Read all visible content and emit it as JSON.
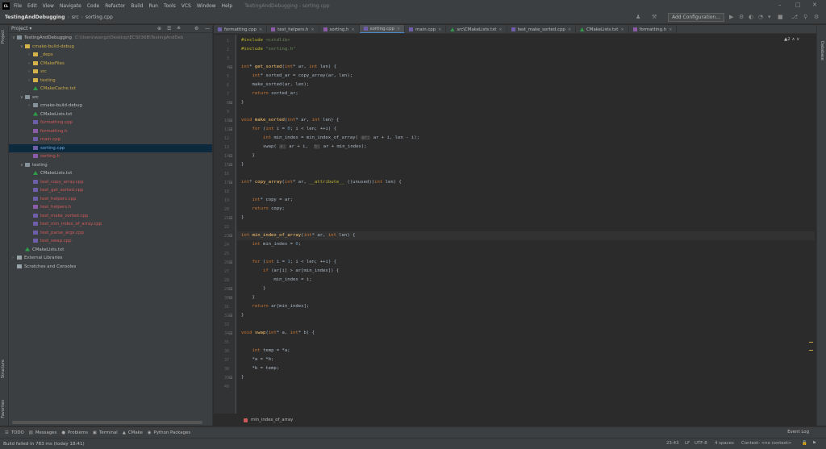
{
  "window": {
    "title": "TestingAndDebugging - sorting.cpp",
    "menu": [
      "File",
      "Edit",
      "View",
      "Navigate",
      "Code",
      "Refactor",
      "Build",
      "Run",
      "Tools",
      "VCS",
      "Window",
      "Help"
    ],
    "controls": {
      "minimize": "–",
      "maximize": "□",
      "close": "✕"
    }
  },
  "navbar": {
    "project": "TestingAndDebugging",
    "crumbs": [
      "src",
      "sorting.cpp"
    ],
    "add_config_label": "Add Configuration..."
  },
  "sidetools": {
    "left": [
      "Project",
      "Structure",
      "Favorites"
    ],
    "right": [
      "Database"
    ]
  },
  "project_panel": {
    "title": "Project ▾",
    "tree": [
      {
        "label": "TestingAndDebugging",
        "path": "C:\\Users\\wangz\\Desktop\\ECS036B\\TestingAndDeb",
        "indent": 0,
        "arrow": "∨",
        "icon": "folder",
        "color": ""
      },
      {
        "label": "cmake-build-debug",
        "indent": 1,
        "arrow": "∨",
        "icon": "fold-y",
        "color": "ylw"
      },
      {
        "label": "_deps",
        "indent": 2,
        "arrow": "›",
        "icon": "fold-y",
        "color": "ylw"
      },
      {
        "label": "CMakeFiles",
        "indent": 2,
        "arrow": "›",
        "icon": "fold-y",
        "color": "ylw"
      },
      {
        "label": "src",
        "indent": 2,
        "arrow": "›",
        "icon": "fold-y",
        "color": "ylw"
      },
      {
        "label": "testing",
        "indent": 2,
        "arrow": "›",
        "icon": "fold-y",
        "color": "ylw"
      },
      {
        "label": "CMakeCache.txt",
        "indent": 2,
        "arrow": "",
        "icon": "txt",
        "color": "ylw"
      },
      {
        "label": "src",
        "indent": 1,
        "arrow": "∨",
        "icon": "folder",
        "color": ""
      },
      {
        "label": "cmake-build-debug",
        "indent": 2,
        "arrow": "›",
        "icon": "folder",
        "color": ""
      },
      {
        "label": "CMakeLists.txt",
        "indent": 2,
        "arrow": "",
        "icon": "txt",
        "color": ""
      },
      {
        "label": "formatting.cpp",
        "indent": 2,
        "arrow": "",
        "icon": "cpp",
        "color": "rgr"
      },
      {
        "label": "formatting.h",
        "indent": 2,
        "arrow": "",
        "icon": "hdr",
        "color": "rgr"
      },
      {
        "label": "main.cpp",
        "indent": 2,
        "arrow": "",
        "icon": "cpp",
        "color": "rgr"
      },
      {
        "label": "sorting.cpp",
        "indent": 2,
        "arrow": "",
        "icon": "cpp",
        "color": "bl",
        "selected": true
      },
      {
        "label": "sorting.h",
        "indent": 2,
        "arrow": "",
        "icon": "hdr",
        "color": "rgr"
      },
      {
        "label": "testing",
        "indent": 1,
        "arrow": "∨",
        "icon": "folder",
        "color": ""
      },
      {
        "label": "CMakeLists.txt",
        "indent": 2,
        "arrow": "",
        "icon": "txt",
        "color": ""
      },
      {
        "label": "test_copy_array.cpp",
        "indent": 2,
        "arrow": "",
        "icon": "cpp",
        "color": "rgr"
      },
      {
        "label": "test_get_sorted.cpp",
        "indent": 2,
        "arrow": "",
        "icon": "cpp",
        "color": "rgr"
      },
      {
        "label": "test_helpers.cpp",
        "indent": 2,
        "arrow": "",
        "icon": "cpp",
        "color": "rgr"
      },
      {
        "label": "test_helpers.h",
        "indent": 2,
        "arrow": "",
        "icon": "hdr",
        "color": "rgr"
      },
      {
        "label": "test_make_sorted.cpp",
        "indent": 2,
        "arrow": "",
        "icon": "cpp",
        "color": "rgr"
      },
      {
        "label": "test_min_index_of_array.cpp",
        "indent": 2,
        "arrow": "",
        "icon": "cpp",
        "color": "rgr"
      },
      {
        "label": "test_parse_args.cpp",
        "indent": 2,
        "arrow": "",
        "icon": "cpp",
        "color": "rgr"
      },
      {
        "label": "test_swap.cpp",
        "indent": 2,
        "arrow": "",
        "icon": "cpp",
        "color": "rgr"
      },
      {
        "label": "CMakeLists.txt",
        "indent": 1,
        "arrow": "",
        "icon": "txt",
        "color": ""
      },
      {
        "label": "External Libraries",
        "indent": 0,
        "arrow": "›",
        "icon": "lib",
        "color": ""
      },
      {
        "label": "Scratches and Consoles",
        "indent": 0,
        "arrow": "",
        "icon": "lib",
        "color": ""
      }
    ]
  },
  "tabs": [
    {
      "label": "formatting.cpp",
      "icon": "cpp"
    },
    {
      "label": "test_helpers.h",
      "icon": "hdr"
    },
    {
      "label": "sorting.h",
      "icon": "hdr"
    },
    {
      "label": "sorting.cpp",
      "icon": "cpp",
      "active": true
    },
    {
      "label": "main.cpp",
      "icon": "cpp"
    },
    {
      "label": "src\\CMakeLists.txt",
      "icon": "txt"
    },
    {
      "label": "test_make_sorted.cpp",
      "icon": "cpp"
    },
    {
      "label": "CMakeLists.txt",
      "icon": "txt"
    },
    {
      "label": "formatting.h",
      "icon": "hdr"
    }
  ],
  "editor": {
    "line_numbers": [
      "1",
      "2",
      "3",
      "4",
      "5",
      "6",
      "7",
      "8",
      "9",
      "10",
      "11",
      "12",
      "13",
      "14",
      "15",
      "16",
      "17",
      "18",
      "19",
      "20",
      "21",
      "22",
      "23",
      "24",
      "25",
      "26",
      "27",
      "28",
      "29",
      "30",
      "31",
      "32",
      "33",
      "34",
      "35",
      "36",
      "37",
      "38",
      "39",
      "40"
    ],
    "current_line": "23",
    "inspection": "▲2 ∧ ∨",
    "lines": [
      [
        [
          "pp",
          "#include "
        ],
        [
          "s",
          "<cstdlib>"
        ]
      ],
      [
        [
          "pp",
          "#include "
        ],
        [
          "s",
          "\"sorting.h\""
        ]
      ],
      [],
      [
        [
          "k",
          "int"
        ],
        [
          "",
          "* "
        ],
        [
          "f",
          "get_sorted"
        ],
        [
          "",
          "("
        ],
        [
          "k",
          "int"
        ],
        [
          "",
          "* ar, "
        ],
        [
          "k",
          "int"
        ],
        [
          "",
          " len) {"
        ]
      ],
      [
        [
          "",
          "    "
        ],
        [
          "k",
          "int"
        ],
        [
          "",
          "* sorted_ar = copy_array(ar, len);"
        ]
      ],
      [
        [
          "",
          "    make_sorted(ar, len);"
        ]
      ],
      [
        [
          "",
          "    "
        ],
        [
          "k",
          "return"
        ],
        [
          "",
          ""
        ],
        [
          "",
          "",
          " "
        ],
        [
          "",
          "sorted_ar;"
        ]
      ],
      [
        [
          "",
          "}"
        ]
      ],
      [],
      [
        [
          "k",
          "void "
        ],
        [
          "f",
          "make_sorted"
        ],
        [
          "",
          "("
        ],
        [
          "k",
          "int"
        ],
        [
          "",
          "* ar, "
        ],
        [
          "k",
          "int"
        ],
        [
          "",
          " len) {"
        ]
      ],
      [
        [
          "",
          "    "
        ],
        [
          "k",
          "for "
        ],
        [
          "",
          "("
        ],
        [
          "k",
          "int "
        ],
        [
          "",
          "i = "
        ],
        [
          "n",
          "0"
        ],
        [
          "",
          "; i < len; ++i) {"
        ]
      ],
      [
        [
          "",
          "        "
        ],
        [
          "k",
          "int "
        ],
        [
          "",
          "min_index = min_index_of_array( "
        ],
        [
          "p",
          "ar:"
        ],
        [
          "",
          " ar + i, len - i);"
        ]
      ],
      [
        [
          "",
          "        swap( "
        ],
        [
          "p",
          "a:"
        ],
        [
          "",
          " ar + i,  "
        ],
        [
          "p",
          "b:"
        ],
        [
          "",
          " ar + min_index);"
        ]
      ],
      [
        [
          "",
          "    }"
        ]
      ],
      [
        [
          "",
          "}"
        ]
      ],
      [],
      [
        [
          "k",
          "int"
        ],
        [
          "",
          "* "
        ],
        [
          "f",
          "copy_array"
        ],
        [
          "",
          "("
        ],
        [
          "k",
          "int"
        ],
        [
          "",
          "* ar, "
        ],
        [
          "h",
          "__attribute__ "
        ],
        [
          "",
          "((unused))"
        ],
        [
          "k",
          "int "
        ],
        [
          "",
          "len) {"
        ]
      ],
      [],
      [
        [
          "",
          "    "
        ],
        [
          "k",
          "int"
        ],
        [
          "",
          "* copy = ar;"
        ]
      ],
      [
        [
          "",
          "    "
        ],
        [
          "k",
          "return "
        ],
        [
          "",
          "copy;"
        ]
      ],
      [
        [
          "",
          "}"
        ]
      ],
      [],
      [
        [
          "k",
          "int "
        ],
        [
          "f",
          "min_index_of_array"
        ],
        [
          "",
          "("
        ],
        [
          "k",
          "int"
        ],
        [
          "",
          "* ar, "
        ],
        [
          "k",
          "int "
        ],
        [
          "",
          "len) {"
        ]
      ],
      [
        [
          "",
          "    "
        ],
        [
          "k",
          "int "
        ],
        [
          "",
          "min_index = "
        ],
        [
          "n",
          "0"
        ],
        [
          "",
          ";"
        ]
      ],
      [],
      [
        [
          "",
          "    "
        ],
        [
          "k",
          "for "
        ],
        [
          "",
          "("
        ],
        [
          "k",
          "int "
        ],
        [
          "",
          "i = "
        ],
        [
          "n",
          "1"
        ],
        [
          "",
          "; i < len; ++i) {"
        ]
      ],
      [
        [
          "",
          "        "
        ],
        [
          "k",
          "if "
        ],
        [
          "",
          "(ar[i] > ar[min_index]) {"
        ]
      ],
      [
        [
          "",
          "            min_index = i;"
        ]
      ],
      [
        [
          "",
          "        }"
        ]
      ],
      [
        [
          "",
          "    }"
        ]
      ],
      [
        [
          "",
          "    "
        ],
        [
          "k",
          "return "
        ],
        [
          "",
          "ar[min_index];"
        ]
      ],
      [
        [
          "",
          "}"
        ]
      ],
      [],
      [
        [
          "k",
          "void "
        ],
        [
          "f",
          "swap"
        ],
        [
          "",
          "("
        ],
        [
          "k",
          "int"
        ],
        [
          "",
          "* a, "
        ],
        [
          "k",
          "int"
        ],
        [
          "",
          "* b) {"
        ]
      ],
      [],
      [
        [
          "",
          "    "
        ],
        [
          "k",
          "int "
        ],
        [
          "",
          "temp = *a;"
        ]
      ],
      [
        [
          "",
          "    *a = *b;"
        ]
      ],
      [
        [
          "",
          "    *b = temp;"
        ]
      ],
      [
        [
          "",
          "}"
        ]
      ],
      []
    ]
  },
  "code_crumb": "min_index_of_array",
  "bottom_tools": [
    {
      "icon": "☰",
      "label": "TODO"
    },
    {
      "icon": "▤",
      "label": "Messages"
    },
    {
      "icon": "●",
      "label": "Problems"
    },
    {
      "icon": "▣",
      "label": "Terminal"
    },
    {
      "icon": "▲",
      "label": "CMake"
    },
    {
      "icon": "◉",
      "label": "Python Packages"
    }
  ],
  "event_log": "Event Log",
  "status": {
    "message": "Build failed in 783 ms (today 18:41)",
    "position": "23:43",
    "line_sep": "LF",
    "encoding": "UTF-8",
    "indent": "4 spaces",
    "context": "Context: <no context>"
  },
  "colors": {
    "accent": "#4a88c7",
    "keyword": "#cc7832",
    "function": "#ffc66d",
    "string": "#6a8759",
    "number": "#6897bb"
  }
}
